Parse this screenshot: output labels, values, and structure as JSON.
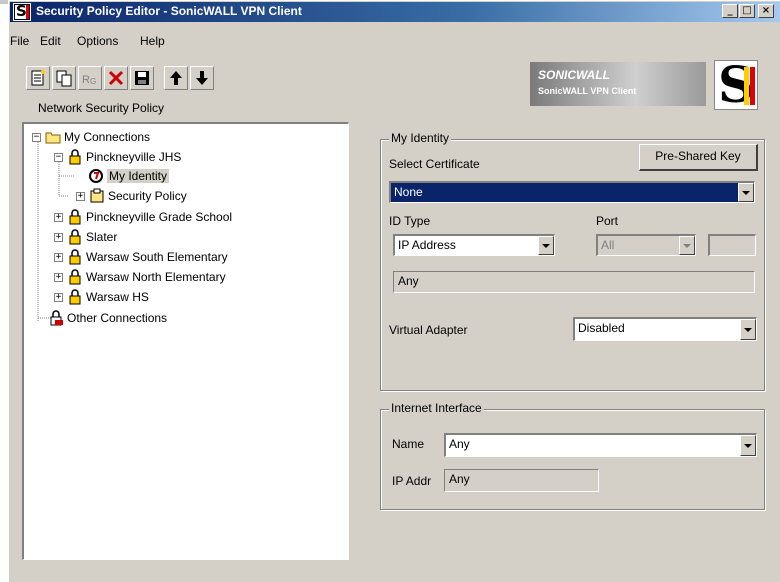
{
  "window": {
    "title": "Security Policy Editor - SonicWALL VPN Client",
    "controls": {
      "minimize": "_",
      "maximize": "□",
      "close": "×"
    }
  },
  "menu": {
    "items": [
      "File",
      "Edit",
      "Options",
      "Help"
    ]
  },
  "toolbar": {
    "buttons": [
      "new-connection",
      "copy",
      "rename",
      "delete",
      "save",
      "move-up",
      "move-down"
    ]
  },
  "logo": {
    "brand": "SONICWALL",
    "subtitle": "SonicWALL VPN Client"
  },
  "left_panel": {
    "label": "Network Security Policy",
    "tree": [
      {
        "label": "My Connections",
        "level": 0,
        "expander": "−",
        "icon": "folder-icon"
      },
      {
        "label": "Pinckneyville JHS",
        "level": 1,
        "expander": "−",
        "icon": "connection-lock-icon"
      },
      {
        "label": "My Identity",
        "level": 2,
        "expander": "",
        "icon": "identity-icon",
        "selected": true
      },
      {
        "label": "Security Policy",
        "level": 2,
        "expander": "+",
        "icon": "security-policy-icon"
      },
      {
        "label": "Pinckneyville Grade School",
        "level": 1,
        "expander": "+",
        "icon": "connection-lock-icon"
      },
      {
        "label": "Slater",
        "level": 1,
        "expander": "+",
        "icon": "connection-lock-icon"
      },
      {
        "label": "Warsaw South Elementary",
        "level": 1,
        "expander": "+",
        "icon": "connection-lock-icon"
      },
      {
        "label": "Warsaw North Elementary",
        "level": 1,
        "expander": "+",
        "icon": "connection-lock-icon"
      },
      {
        "label": "Warsaw HS",
        "level": 1,
        "expander": "+",
        "icon": "connection-lock-icon"
      },
      {
        "label": "Other Connections",
        "level": 0,
        "expander": "",
        "icon": "other-connections-icon"
      }
    ]
  },
  "identity": {
    "group_title": "My Identity",
    "select_certificate_label": "Select Certificate",
    "pre_shared_key_button": "Pre-Shared Key",
    "certificate_value": "None",
    "id_type_label": "ID Type",
    "id_type_value": "IP Address",
    "port_label": "Port",
    "port_value": "All",
    "port_number": "",
    "id_value": "Any",
    "virtual_adapter_label": "Virtual Adapter",
    "virtual_adapter_value": "Disabled"
  },
  "internet_interface": {
    "group_title": "Internet Interface",
    "name_label": "Name",
    "name_value": "Any",
    "ip_addr_label": "IP Addr",
    "ip_addr_value": "Any"
  }
}
